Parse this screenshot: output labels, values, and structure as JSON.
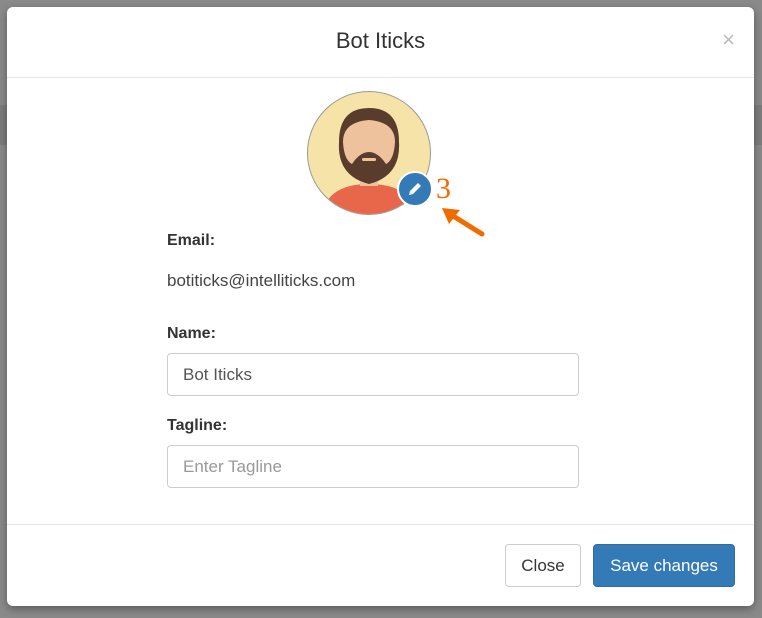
{
  "modal": {
    "title": "Bot Iticks",
    "close_symbol": "×"
  },
  "avatar": {
    "icon": "bearded-man-avatar",
    "edit_icon": "pencil-icon",
    "annotation_number": "3",
    "annotation_color": "#f06b00"
  },
  "form": {
    "email_label": "Email:",
    "email_value": "botiticks@intelliticks.com",
    "name_label": "Name:",
    "name_value": "Bot Iticks",
    "tagline_label": "Tagline:",
    "tagline_placeholder": "Enter Tagline"
  },
  "footer": {
    "close_label": "Close",
    "save_label": "Save changes"
  },
  "colors": {
    "primary": "#337ab7",
    "avatar_bg": "#f6e3a8",
    "shirt": "#e8674a",
    "beard": "#5a3c2c"
  }
}
